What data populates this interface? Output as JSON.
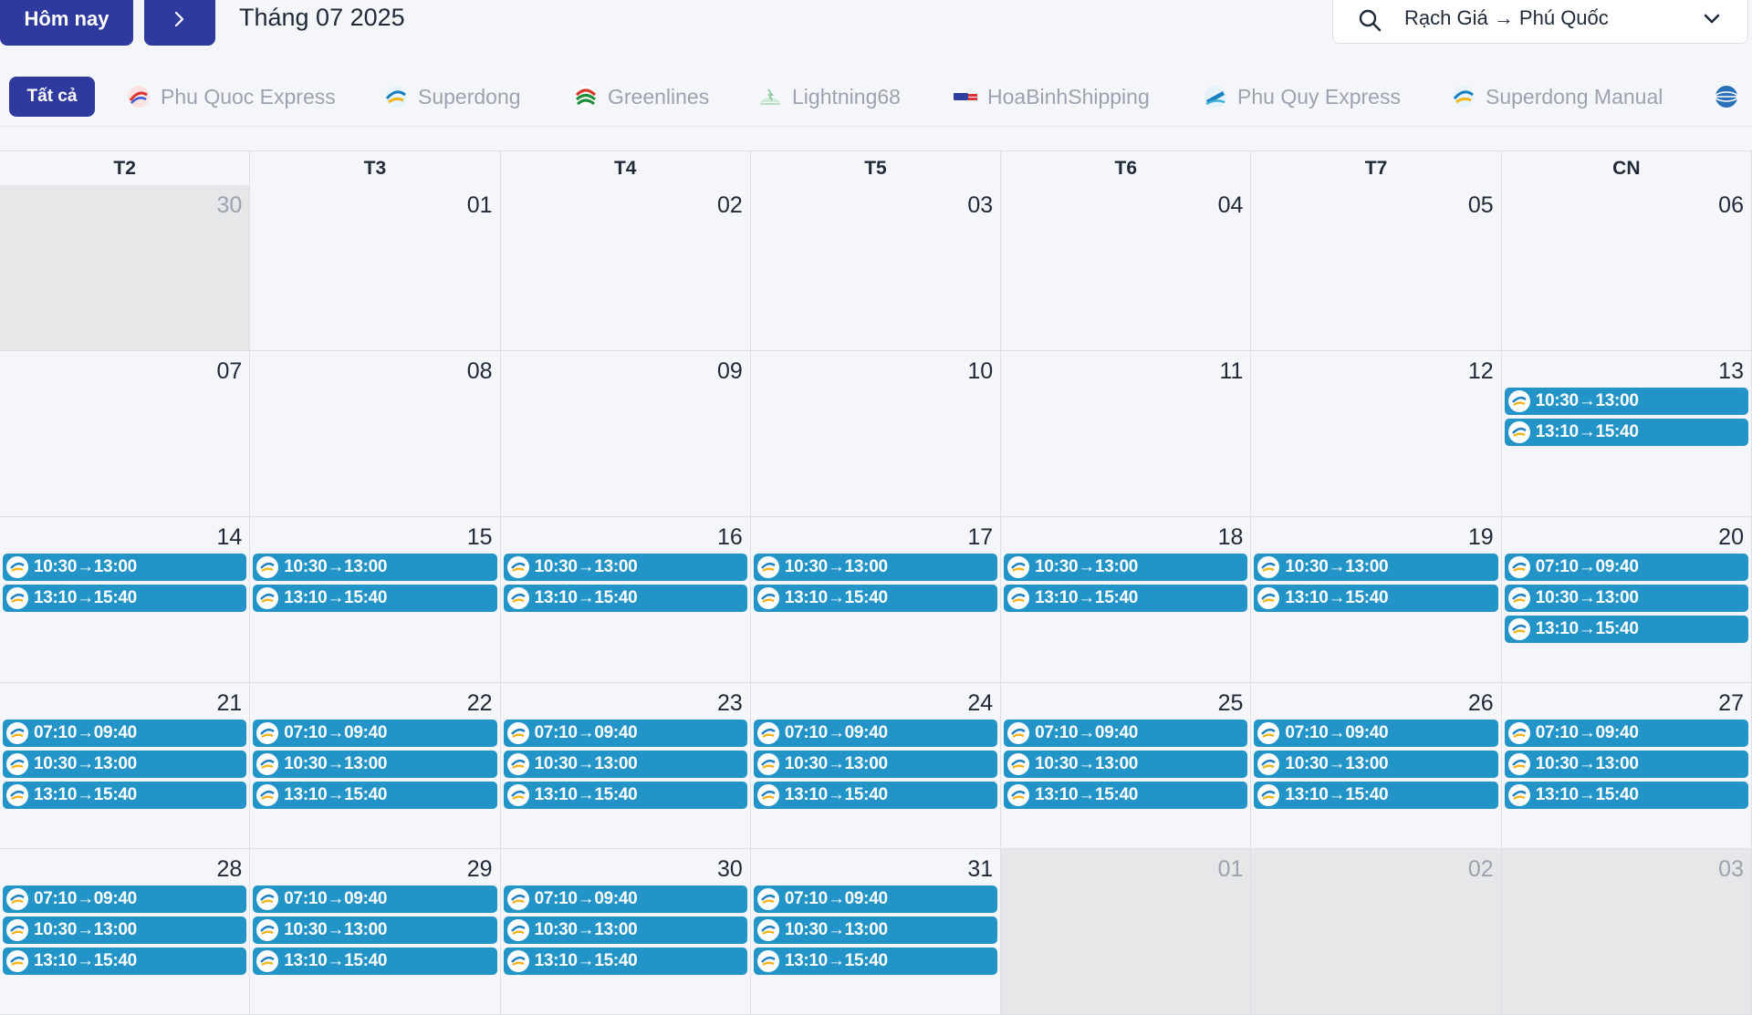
{
  "toolbar": {
    "today_label": "Hôm nay",
    "month_title": "Tháng 07 2025",
    "route": "Rạch Giá → Phú Quốc"
  },
  "filters": {
    "all_label": "Tất cả",
    "operators": [
      {
        "label": "Phu Quoc Express",
        "icon": "phu-quoc-express-logo"
      },
      {
        "label": "Superdong",
        "icon": "superdong-logo"
      },
      {
        "label": "Greenlines",
        "icon": "greenlines-logo"
      },
      {
        "label": "Lightning68",
        "icon": "lightning68-logo"
      },
      {
        "label": "HoaBinhShipping",
        "icon": "hoabinh-shipping-logo"
      },
      {
        "label": "Phu Quy Express",
        "icon": "phu-quy-express-logo"
      },
      {
        "label": "Superdong Manual",
        "icon": "superdong-manual-logo"
      }
    ]
  },
  "calendar": {
    "weekdays": [
      "T2",
      "T3",
      "T4",
      "T5",
      "T6",
      "T7",
      "CN"
    ],
    "weeks": [
      [
        {
          "day": "30",
          "other": true,
          "trips": []
        },
        {
          "day": "01",
          "trips": []
        },
        {
          "day": "02",
          "trips": []
        },
        {
          "day": "03",
          "trips": []
        },
        {
          "day": "04",
          "trips": []
        },
        {
          "day": "05",
          "trips": []
        },
        {
          "day": "06",
          "trips": []
        }
      ],
      [
        {
          "day": "07",
          "trips": []
        },
        {
          "day": "08",
          "trips": []
        },
        {
          "day": "09",
          "trips": []
        },
        {
          "day": "10",
          "trips": []
        },
        {
          "day": "11",
          "trips": []
        },
        {
          "day": "12",
          "trips": []
        },
        {
          "day": "13",
          "trips": [
            "10:30→13:00",
            "13:10→15:40"
          ]
        }
      ],
      [
        {
          "day": "14",
          "trips": [
            "10:30→13:00",
            "13:10→15:40"
          ]
        },
        {
          "day": "15",
          "trips": [
            "10:30→13:00",
            "13:10→15:40"
          ]
        },
        {
          "day": "16",
          "trips": [
            "10:30→13:00",
            "13:10→15:40"
          ]
        },
        {
          "day": "17",
          "trips": [
            "10:30→13:00",
            "13:10→15:40"
          ]
        },
        {
          "day": "18",
          "trips": [
            "10:30→13:00",
            "13:10→15:40"
          ]
        },
        {
          "day": "19",
          "trips": [
            "10:30→13:00",
            "13:10→15:40"
          ]
        },
        {
          "day": "20",
          "trips": [
            "07:10→09:40",
            "10:30→13:00",
            "13:10→15:40"
          ]
        }
      ],
      [
        {
          "day": "21",
          "trips": [
            "07:10→09:40",
            "10:30→13:00",
            "13:10→15:40"
          ]
        },
        {
          "day": "22",
          "trips": [
            "07:10→09:40",
            "10:30→13:00",
            "13:10→15:40"
          ]
        },
        {
          "day": "23",
          "trips": [
            "07:10→09:40",
            "10:30→13:00",
            "13:10→15:40"
          ]
        },
        {
          "day": "24",
          "trips": [
            "07:10→09:40",
            "10:30→13:00",
            "13:10→15:40"
          ]
        },
        {
          "day": "25",
          "trips": [
            "07:10→09:40",
            "10:30→13:00",
            "13:10→15:40"
          ]
        },
        {
          "day": "26",
          "trips": [
            "07:10→09:40",
            "10:30→13:00",
            "13:10→15:40"
          ]
        },
        {
          "day": "27",
          "trips": [
            "07:10→09:40",
            "10:30→13:00",
            "13:10→15:40"
          ]
        }
      ],
      [
        {
          "day": "28",
          "trips": [
            "07:10→09:40",
            "10:30→13:00",
            "13:10→15:40"
          ]
        },
        {
          "day": "29",
          "trips": [
            "07:10→09:40",
            "10:30→13:00",
            "13:10→15:40"
          ]
        },
        {
          "day": "30",
          "trips": [
            "07:10→09:40",
            "10:30→13:00",
            "13:10→15:40"
          ]
        },
        {
          "day": "31",
          "trips": [
            "07:10→09:40",
            "10:30→13:00",
            "13:10→15:40"
          ]
        },
        {
          "day": "01",
          "other": true,
          "trips": []
        },
        {
          "day": "02",
          "other": true,
          "trips": []
        },
        {
          "day": "03",
          "other": true,
          "trips": []
        }
      ]
    ]
  },
  "colors": {
    "primary": "#2f3a9e",
    "trip": "#2394c8",
    "other_month": "#e6e7e9",
    "background": "#f4f6f9"
  }
}
